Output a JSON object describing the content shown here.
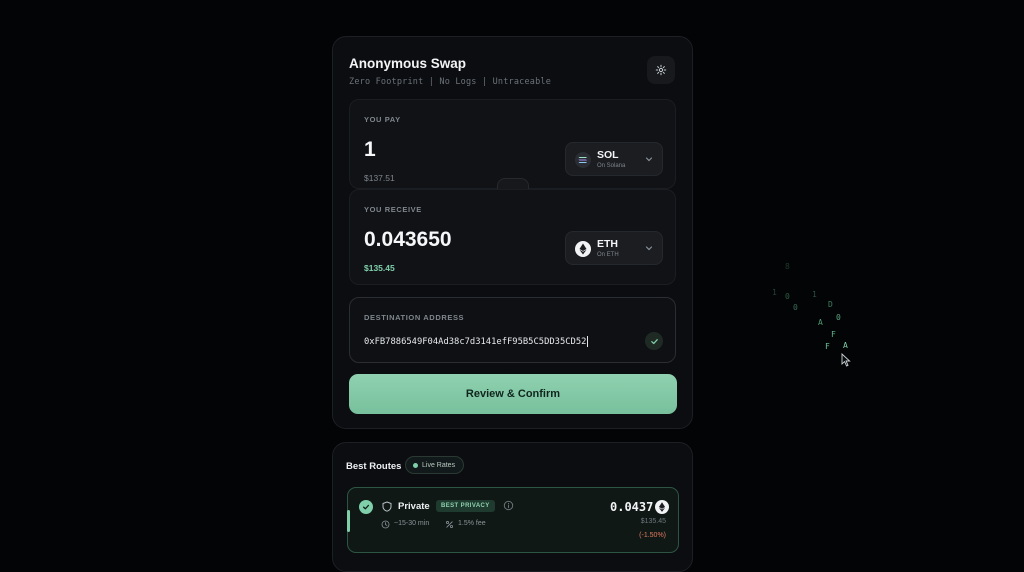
{
  "swap": {
    "title": "Anonymous Swap",
    "subtitle": "Zero Footprint | No Logs | Untraceable",
    "pay": {
      "label": "YOU PAY",
      "amount": "1",
      "usd": "$137.51",
      "token": {
        "symbol": "SOL",
        "chain": "On Solana",
        "icon": "solana-icon"
      }
    },
    "receive": {
      "label": "YOU RECEIVE",
      "amount": "0.043650",
      "usd": "$135.45",
      "token": {
        "symbol": "ETH",
        "chain": "On ETH",
        "icon": "ethereum-icon"
      }
    },
    "destination": {
      "label": "DESTINATION ADDRESS",
      "value": "0xFB7886549F04Ad38c7d3141efF95B5C5DD35CD52"
    },
    "confirm_label": "Review & Confirm"
  },
  "routes": {
    "title": "Best Routes",
    "live_label": "Live Rates",
    "items": [
      {
        "name": "Private",
        "badge": "BEST PRIVACY",
        "time": "~15-30 min",
        "fee": "1.5% fee",
        "amount": "0.0437",
        "usd": "$135.45",
        "diff": "(-1.50%)"
      }
    ]
  },
  "background": {
    "glyphs": [
      "1",
      "0",
      "1",
      "D",
      "0",
      "A",
      "0",
      "F",
      "F",
      "A",
      "8"
    ]
  },
  "colors": {
    "accent": "#7fcfab",
    "background": "#030405",
    "card": "#0c0d10",
    "negative": "#e07a5f"
  }
}
